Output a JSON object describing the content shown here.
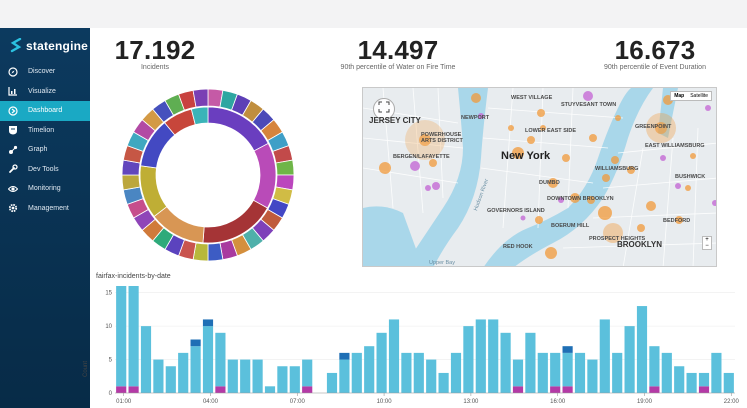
{
  "app": {
    "brand": "statengine"
  },
  "sidebar": {
    "items": [
      {
        "label": "Discover",
        "icon": "compass-icon"
      },
      {
        "label": "Visualize",
        "icon": "bar-chart-icon"
      },
      {
        "label": "Dashboard",
        "icon": "dashboard-icon",
        "active": true
      },
      {
        "label": "Timelion",
        "icon": "shield-icon"
      },
      {
        "label": "Graph",
        "icon": "graph-icon"
      },
      {
        "label": "Dev Tools",
        "icon": "wrench-icon"
      },
      {
        "label": "Monitoring",
        "icon": "eye-icon"
      },
      {
        "label": "Management",
        "icon": "gear-icon"
      }
    ]
  },
  "kpis": [
    {
      "value": "17.192",
      "label": "Incidents"
    },
    {
      "value": "14.497",
      "label": "90th percentile of Water on Fire Time"
    },
    {
      "value": "16.673",
      "label": "90th percentile of Event Duration"
    }
  ],
  "map": {
    "labels": [
      "JERSEY CITY",
      "POWERHOUSE ARTS DISTRICT",
      "BERGEN/LAFAYETTE",
      "New York",
      "NEWPORT",
      "WEST VILLAGE",
      "STUYVESANT TOWN",
      "LOWER EAST SIDE",
      "GREENPOINT",
      "EAST WILLIAMSBURG",
      "WILLIAMSBURG",
      "DUMBO",
      "DOWNTOWN BROOKLYN",
      "BOERUM HILL",
      "PROSPECT HEIGHTS",
      "BROOKLYN",
      "RED HOOK",
      "GOVERNORS ISLAND",
      "Hudson River",
      "Upper Bay",
      "BUSHWICK",
      "BEDFORD"
    ],
    "buttons": {
      "map": "Map",
      "satellite": "Satellite"
    },
    "zoom_in": "+",
    "zoom_out": "−"
  },
  "bar_chart_title": "fairfax-incidents-by-date",
  "chart_data": {
    "type": "bar",
    "title": "fairfax-incidents-by-date",
    "xlabel": "",
    "ylabel": "Count",
    "ylim": [
      0,
      16
    ],
    "yticks": [
      0,
      5,
      10,
      15
    ],
    "xtick_labels": [
      "01:00",
      "04:00",
      "07:00",
      "10:00",
      "13:00",
      "16:00",
      "19:00",
      "22:00"
    ],
    "colors": [
      "#5bc0dc",
      "#1f6fb5",
      "#b43aa6"
    ],
    "series": [
      {
        "values": [
          15,
          15,
          10,
          5,
          4,
          6,
          7,
          10,
          8,
          5,
          5,
          5,
          1,
          4,
          4,
          4,
          0,
          3,
          5,
          6,
          7,
          9,
          11,
          6,
          6,
          5,
          3,
          6,
          10,
          11,
          11,
          9,
          4,
          9,
          6,
          5,
          5,
          6,
          5,
          11,
          6,
          10,
          13,
          6,
          6,
          4,
          3,
          2,
          6,
          3
        ]
      },
      {
        "values": [
          0,
          0,
          0,
          0,
          0,
          0,
          1,
          1,
          0,
          0,
          0,
          0,
          0,
          0,
          0,
          0,
          0,
          0,
          1,
          0,
          0,
          0,
          0,
          0,
          0,
          0,
          0,
          0,
          0,
          0,
          0,
          0,
          0,
          0,
          0,
          0,
          1,
          0,
          0,
          0,
          0,
          0,
          0,
          0,
          0,
          0,
          0,
          0,
          0,
          0
        ]
      },
      {
        "values": [
          1,
          1,
          0,
          0,
          0,
          0,
          0,
          0,
          1,
          0,
          0,
          0,
          0,
          0,
          0,
          1,
          0,
          0,
          0,
          0,
          0,
          0,
          0,
          0,
          0,
          0,
          0,
          0,
          0,
          0,
          0,
          0,
          1,
          0,
          0,
          1,
          1,
          0,
          0,
          0,
          0,
          0,
          0,
          1,
          0,
          0,
          0,
          1,
          0,
          0
        ]
      }
    ]
  },
  "donut_data": {
    "type": "pie",
    "inner": [
      {
        "value": 22,
        "color": "#6a3ebf"
      },
      {
        "value": 20,
        "color": "#b94bb8"
      },
      {
        "value": 23,
        "color": "#a53436"
      },
      {
        "value": 17,
        "color": "#d89654"
      },
      {
        "value": 16,
        "color": "#bfae35"
      },
      {
        "value": 15,
        "color": "#4349c2"
      },
      {
        "value": 9,
        "color": "#c7463b"
      },
      {
        "value": 5,
        "color": "#3ab4b8"
      }
    ],
    "outer": [
      "#c55aa6",
      "#2ea6a1",
      "#5d3fb6",
      "#c08e3e",
      "#4b4ab8",
      "#d6843c",
      "#3f9fc7",
      "#c24a4a",
      "#6fb548",
      "#bb46bd",
      "#d0bc45",
      "#4347c5",
      "#c05b3b",
      "#7e41b9",
      "#4fb0aa",
      "#d48f3d",
      "#a83a9f",
      "#3d5cc4",
      "#b8b83b",
      "#c9544e",
      "#5b43be",
      "#2eaa7a",
      "#d07a3a",
      "#8f45b8",
      "#c64d8c",
      "#4a86c2",
      "#bca73d",
      "#6246bd",
      "#c65745",
      "#40a8c0",
      "#b24aa4",
      "#d39a45",
      "#4551bd",
      "#5fae52",
      "#c8423f",
      "#7a3fb4"
    ]
  }
}
